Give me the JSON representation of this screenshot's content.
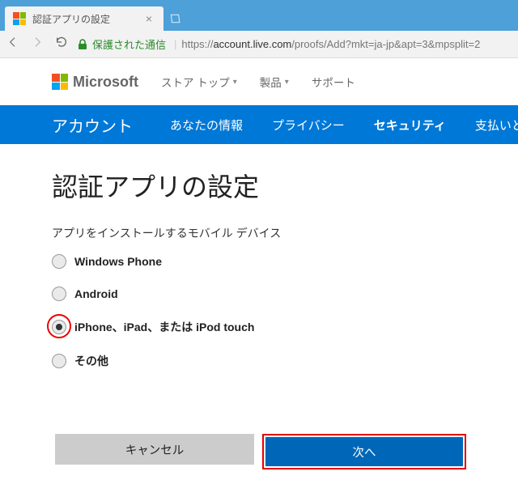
{
  "tab": {
    "title": "認証アプリの設定"
  },
  "address": {
    "secure_label": "保護された通信",
    "url_prefix": "https://",
    "url_host": "account.live.com",
    "url_path": "/proofs/Add?mkt=ja-jp&apt=3&mpsplit=2"
  },
  "header": {
    "brand": "Microsoft",
    "links": [
      "ストア トップ",
      "製品",
      "サポート"
    ]
  },
  "nav": {
    "title": "アカウント",
    "items": [
      "あなたの情報",
      "プライバシー",
      "セキュリティ",
      "支払いと請"
    ]
  },
  "page": {
    "title": "認証アプリの設定",
    "prompt": "アプリをインストールするモバイル デバイス",
    "options": [
      {
        "label": "Windows Phone",
        "selected": false
      },
      {
        "label": "Android",
        "selected": false
      },
      {
        "label": "iPhone、iPad、または iPod touch",
        "selected": true
      },
      {
        "label": "その他",
        "selected": false
      }
    ],
    "cancel": "キャンセル",
    "next": "次へ"
  }
}
